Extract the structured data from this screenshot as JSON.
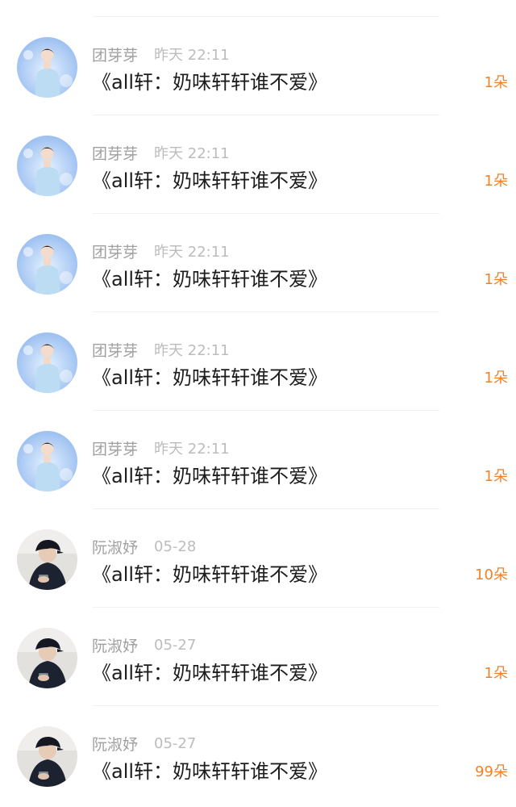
{
  "items": [
    {
      "avatar_icon": "blue-stage-avatar-icon",
      "name": "团芽芽",
      "time": "昨天 22:11",
      "title": "《all轩：奶味轩轩谁不爱》",
      "count": "1朵"
    },
    {
      "avatar_icon": "blue-stage-avatar-icon",
      "name": "团芽芽",
      "time": "昨天 22:11",
      "title": "《all轩：奶味轩轩谁不爱》",
      "count": "1朵"
    },
    {
      "avatar_icon": "blue-stage-avatar-icon",
      "name": "团芽芽",
      "time": "昨天 22:11",
      "title": "《all轩：奶味轩轩谁不爱》",
      "count": "1朵"
    },
    {
      "avatar_icon": "blue-stage-avatar-icon",
      "name": "团芽芽",
      "time": "昨天 22:11",
      "title": "《all轩：奶味轩轩谁不爱》",
      "count": "1朵"
    },
    {
      "avatar_icon": "blue-stage-avatar-icon",
      "name": "团芽芽",
      "time": "昨天 22:11",
      "title": "《all轩：奶味轩轩谁不爱》",
      "count": "1朵"
    },
    {
      "avatar_icon": "capped-person-phone-avatar-icon",
      "name": "阮淑妤",
      "time": "05-28",
      "title": "《all轩：奶味轩轩谁不爱》",
      "count": "10朵"
    },
    {
      "avatar_icon": "capped-person-phone-avatar-icon",
      "name": "阮淑妤",
      "time": "05-27",
      "title": "《all轩：奶味轩轩谁不爱》",
      "count": "1朵"
    },
    {
      "avatar_icon": "capped-person-phone-avatar-icon",
      "name": "阮淑妤",
      "time": "05-27",
      "title": "《all轩：奶味轩轩谁不爱》",
      "count": "99朵"
    }
  ],
  "colors": {
    "count": "#f0822a",
    "name": "#a0a0a0",
    "time": "#bcbcbc",
    "title": "#1c1c1c",
    "divider": "#f0f0f0"
  }
}
